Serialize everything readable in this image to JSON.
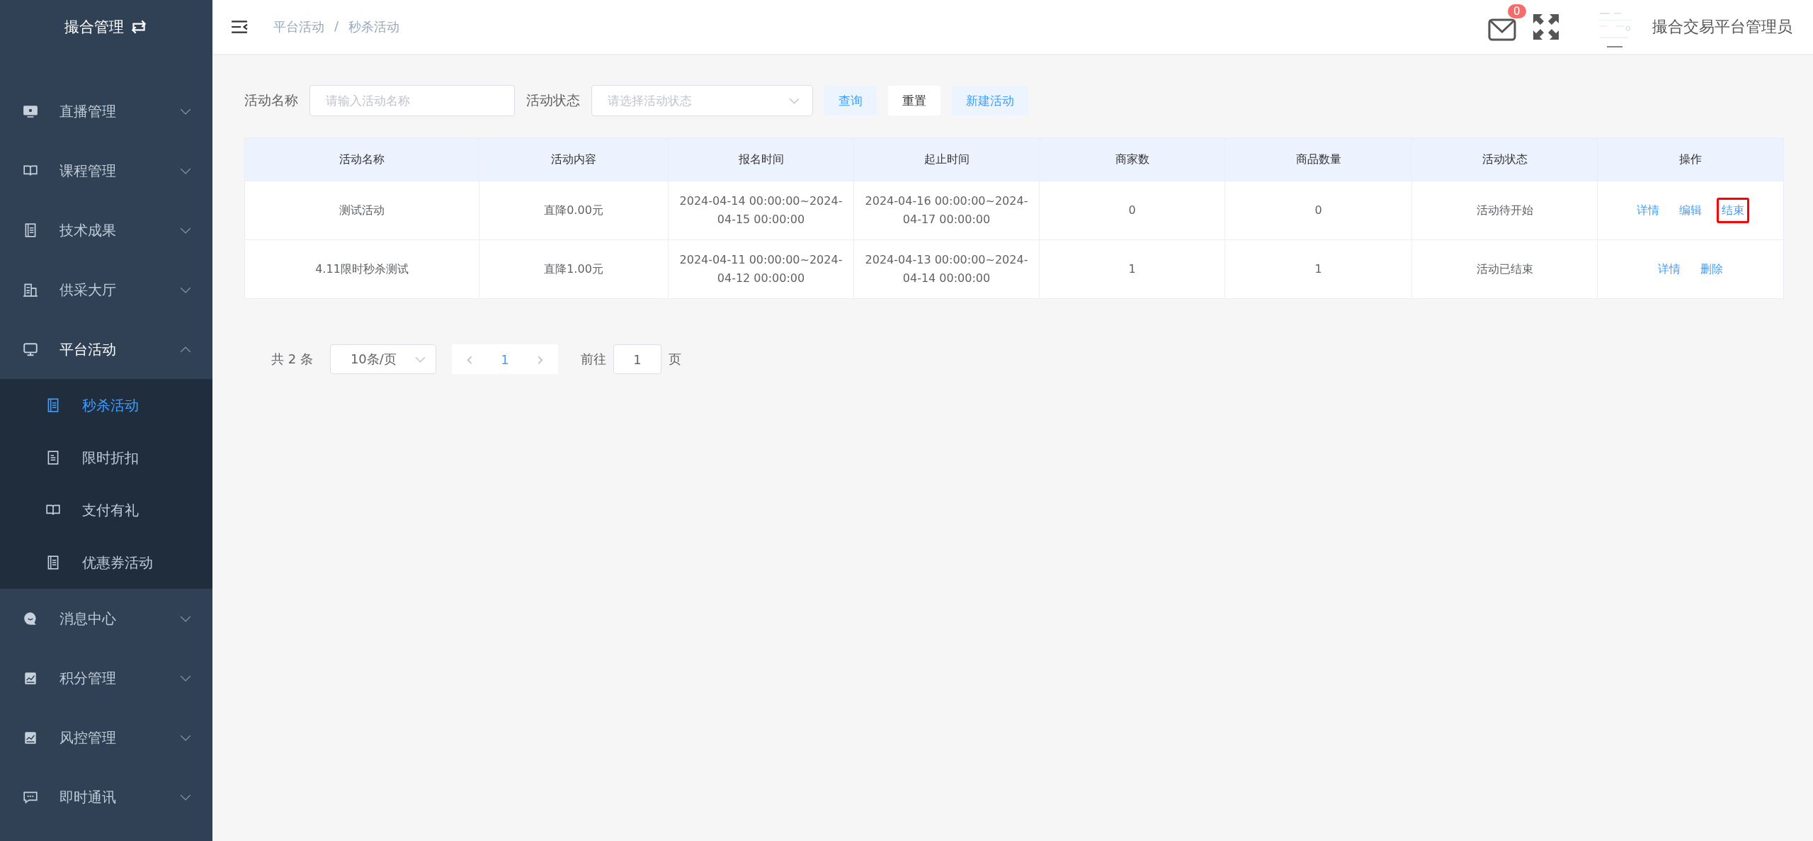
{
  "sidebar": {
    "title": "撮合管理",
    "items": [
      {
        "label": "直播管理",
        "kind": "monitor",
        "expanded": false
      },
      {
        "label": "课程管理",
        "kind": "book",
        "expanded": false
      },
      {
        "label": "技术成果",
        "kind": "doc",
        "expanded": false
      },
      {
        "label": "供采大厅",
        "kind": "building",
        "expanded": false
      },
      {
        "label": "平台活动",
        "kind": "screen",
        "expanded": true,
        "children": [
          {
            "label": "秒杀活动",
            "kind": "doc",
            "selected": true
          },
          {
            "label": "限时折扣",
            "kind": "note",
            "selected": false
          },
          {
            "label": "支付有礼",
            "kind": "book",
            "selected": false
          },
          {
            "label": "优惠券活动",
            "kind": "doc",
            "selected": false
          }
        ]
      },
      {
        "label": "消息中心",
        "kind": "bubble",
        "expanded": false
      },
      {
        "label": "积分管理",
        "kind": "chart",
        "expanded": false
      },
      {
        "label": "风控管理",
        "kind": "chart",
        "expanded": false
      },
      {
        "label": "即时通讯",
        "kind": "chat",
        "expanded": false
      }
    ]
  },
  "header": {
    "breadcrumb": [
      "平台活动",
      "秒杀活动"
    ],
    "separator": "/",
    "mail_badge": "0",
    "user": "撮合交易平台管理员",
    "avatar": {
      "kind": "picture"
    }
  },
  "filters": [
    {
      "label": "活动名称",
      "placeholder": "请输入活动名称",
      "kind": "input"
    },
    {
      "label": "活动状态",
      "placeholder": "请选择活动状态",
      "kind": "select"
    }
  ],
  "buttons": [
    {
      "label": "查询",
      "kind": "primary"
    },
    {
      "label": "重置",
      "kind": "plain"
    },
    {
      "label": "新建活动",
      "kind": "primary"
    }
  ],
  "table": {
    "columns": [
      "活动名称",
      "活动内容",
      "报名时间",
      "起止时间",
      "商家数",
      "商品数量",
      "活动状态",
      "操作"
    ],
    "rows": [
      {
        "cells": [
          "测试活动",
          "直降0.00元",
          "2024-04-14 00:00:00~2024-04-15 00:00:00",
          "2024-04-16 00:00:00~2024-04-17 00:00:00",
          "0",
          "0",
          "活动待开始"
        ],
        "actions": [
          {
            "label": "详情",
            "highlighted": false
          },
          {
            "label": "编辑",
            "highlighted": false
          },
          {
            "label": "结束",
            "highlighted": true
          }
        ]
      },
      {
        "cells": [
          "4.11限时秒杀测试",
          "直降1.00元",
          "2024-04-11 00:00:00~2024-04-12 00:00:00",
          "2024-04-13 00:00:00~2024-04-14 00:00:00",
          "1",
          "1",
          "活动已结束"
        ],
        "actions": [
          {
            "label": "详情",
            "highlighted": false
          },
          {
            "label": "删除",
            "highlighted": false
          }
        ]
      }
    ]
  },
  "pagination": {
    "total": "共 2 条",
    "page_size": "10条/页",
    "prev": "‹",
    "next": "›",
    "pages": [
      {
        "label": "1",
        "selected": true
      }
    ],
    "goto_label": "前往",
    "goto_value": "1",
    "goto_suffix": "页"
  }
}
